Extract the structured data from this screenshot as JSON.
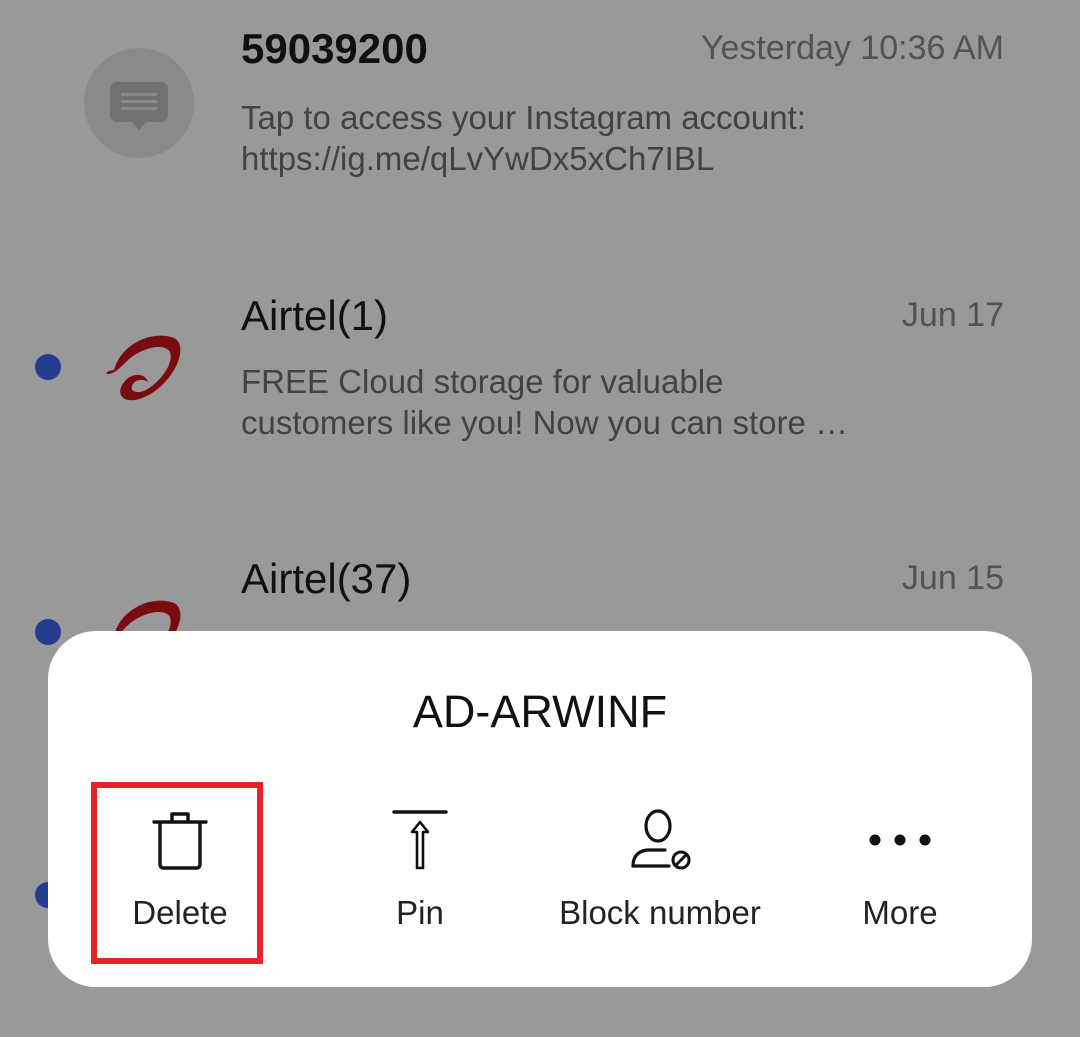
{
  "conversations": [
    {
      "sender": "59039200",
      "time": "Yesterday 10:36 AM",
      "preview_lines": [
        "Tap to access your Instagram account:",
        "https://ig.me/qLvYwDx5xCh7IBL"
      ],
      "avatar": "message-icon",
      "unread": false
    },
    {
      "sender": "Airtel(1)",
      "time": "Jun 17",
      "preview_lines": [
        "FREE Cloud storage for valuable",
        "customers like you! Now you can store …"
      ],
      "avatar": "airtel-logo",
      "unread": true
    },
    {
      "sender": "Airtel(37)",
      "time": "Jun 15",
      "preview_lines": [],
      "avatar": "airtel-logo",
      "unread": true
    }
  ],
  "sheet": {
    "title": "AD-ARWINF",
    "actions": [
      {
        "label": "Delete",
        "icon": "trash-icon"
      },
      {
        "label": "Pin",
        "icon": "pin-icon"
      },
      {
        "label": "Block number",
        "icon": "block-user-icon"
      },
      {
        "label": "More",
        "icon": "more-icon"
      }
    ]
  },
  "colors": {
    "unread_dot": "#3d63f0",
    "airtel_red": "#c8151b",
    "highlight": "#e8222a"
  }
}
